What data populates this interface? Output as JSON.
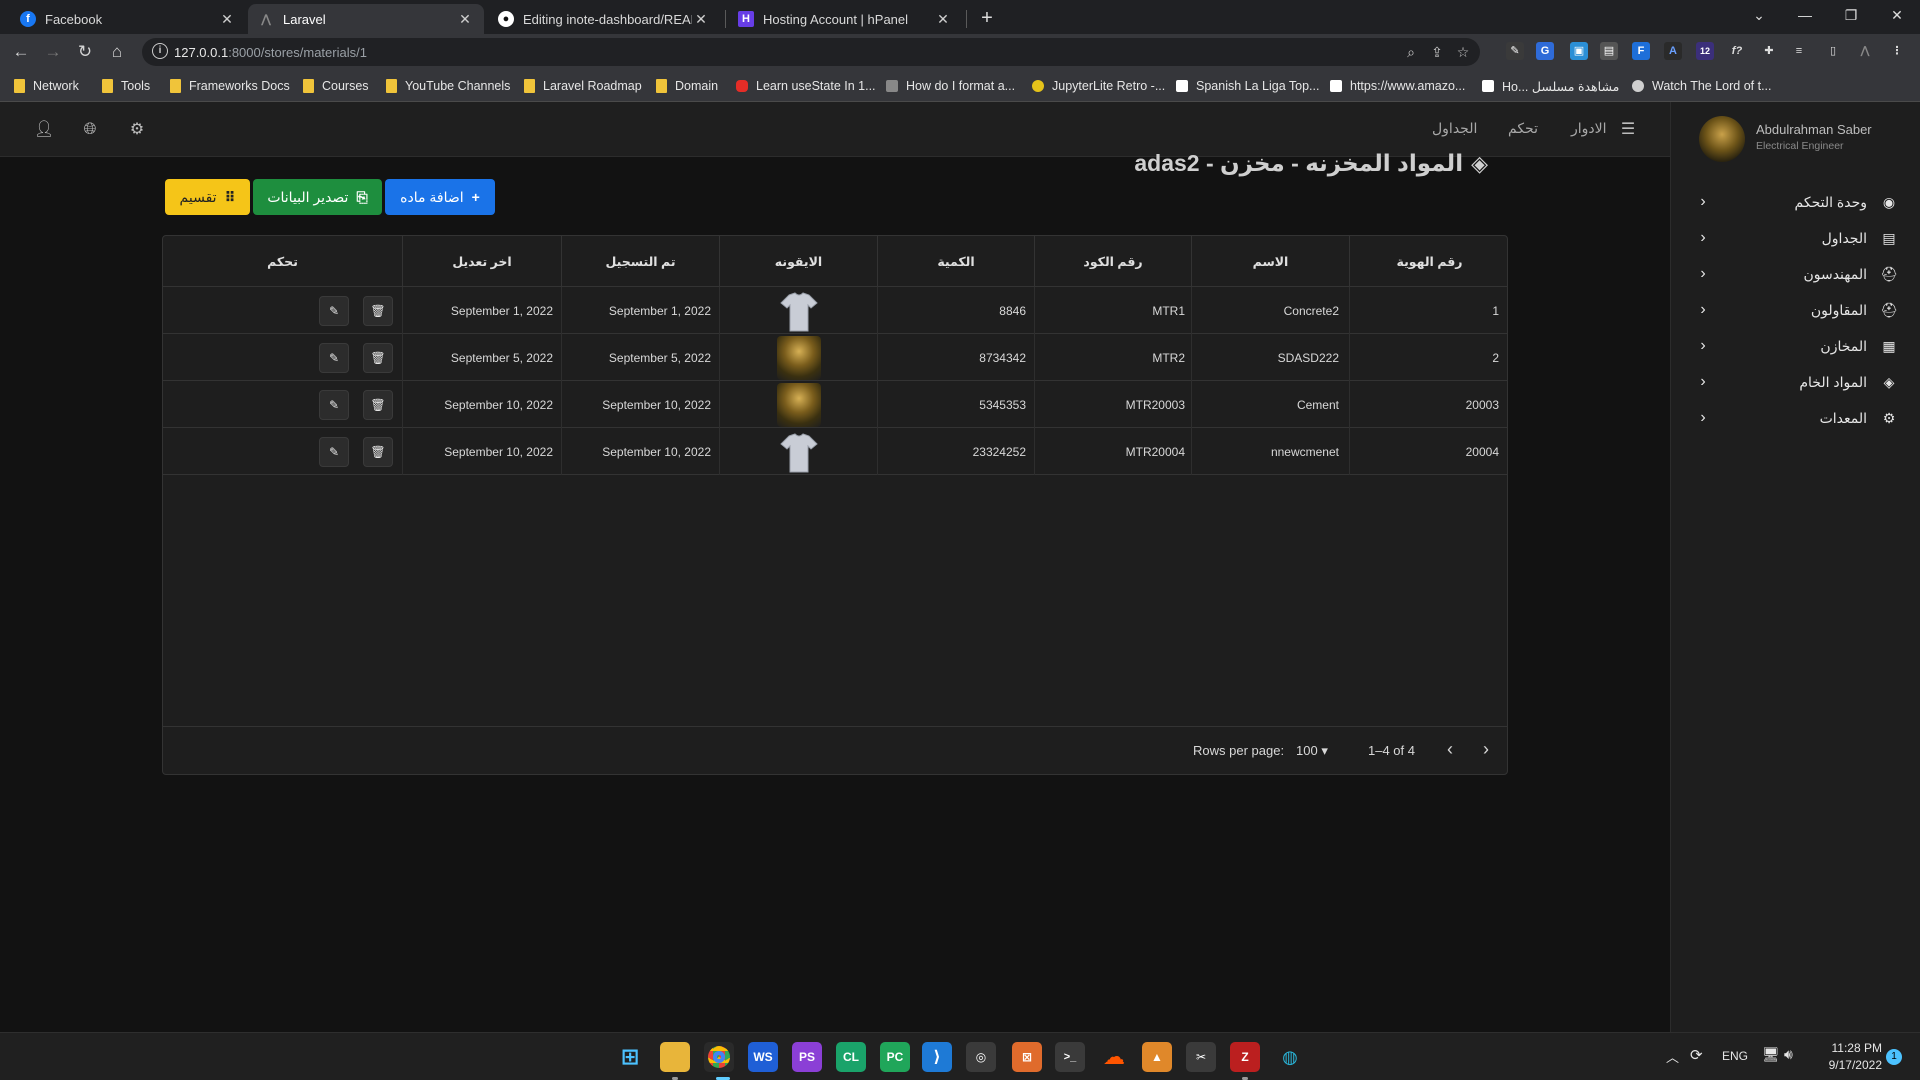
{
  "browser": {
    "tabs": [
      {
        "title": "Facebook",
        "icon": "facebook-icon",
        "color": "#1877f2"
      },
      {
        "title": "Laravel",
        "icon": "laravel-icon",
        "color": "#5f6368"
      },
      {
        "title": "Editing inote-dashboard/README",
        "icon": "github-icon",
        "color": "#ffffff"
      },
      {
        "title": "Hosting Account | hPanel",
        "icon": "hostinger-icon",
        "color": "#673de6"
      }
    ],
    "url_host": "127.0.0.1",
    "url_rest": ":8000/stores/materials/1",
    "bookmarks": [
      "Network",
      "Tools",
      "Frameworks Docs",
      "Courses",
      "YouTube Channels",
      "Laravel Roadmap",
      "Domain",
      "Learn useState In 1...",
      "How do I format a...",
      "JupyterLite Retro -...",
      "Spanish La Liga Top...",
      "https://www.amazo...",
      "Ho... مشاهدة مسلسل",
      "Watch The Lord of t..."
    ],
    "ext_badge": "12"
  },
  "topbar": {
    "nav": [
      "الادوار",
      "تحكم",
      "الجداول"
    ]
  },
  "user": {
    "name": "Abdulrahman Saber",
    "role": "Electrical Engineer"
  },
  "sidebar": {
    "items": [
      {
        "label": "وحدة التحكم",
        "icon": "dashboard-icon"
      },
      {
        "label": "الجداول",
        "icon": "table-icon"
      },
      {
        "label": "المهندسون",
        "icon": "hardhat-icon"
      },
      {
        "label": "المقاولون",
        "icon": "hardhat-icon"
      },
      {
        "label": "المخازن",
        "icon": "warehouse-icon"
      },
      {
        "label": "المواد الخام",
        "icon": "layers-icon"
      },
      {
        "label": "المعدات",
        "icon": "equipment-icon"
      }
    ]
  },
  "page": {
    "title": "المواد المخزنه - مخزن - adas2",
    "buttons": {
      "add": "اضافة ماده",
      "export": "تصدير البيانات",
      "divide": "تقسيم"
    }
  },
  "table": {
    "headers": [
      "رقم الهوية",
      "الاسم",
      "رقم الكود",
      "الكمية",
      "الايقونه",
      "تم التسجيل",
      "اخر تعديل",
      "تحكم"
    ],
    "rows": [
      {
        "id": "1",
        "name": "Concrete2",
        "code": "MTR1",
        "qty": "8846",
        "icon": "tshirt",
        "created": "September 1, 2022",
        "updated": "September 1, 2022"
      },
      {
        "id": "2",
        "name": "SDASD222",
        "code": "MTR2",
        "qty": "8734342",
        "icon": "soldier",
        "created": "September 5, 2022",
        "updated": "September 5, 2022"
      },
      {
        "id": "20003",
        "name": "Cement",
        "code": "MTR20003",
        "qty": "5345353",
        "icon": "soldier",
        "created": "September 10, 2022",
        "updated": "September 10, 2022"
      },
      {
        "id": "20004",
        "name": "nnewcmenet",
        "code": "MTR20004",
        "qty": "23324252",
        "icon": "tshirt",
        "created": "September 10, 2022",
        "updated": "September 10, 2022"
      }
    ],
    "footer": {
      "rows_per_page_label": "Rows per page:",
      "rows_per_page": "100",
      "range": "1–4 of 4"
    }
  },
  "taskbar": {
    "lang": "ENG",
    "time": "11:28 PM",
    "date": "9/17/2022",
    "notif": "1"
  },
  "colors": {
    "add": "#1a73e8",
    "export": "#1e8e3e",
    "divide": "#f5c518"
  }
}
